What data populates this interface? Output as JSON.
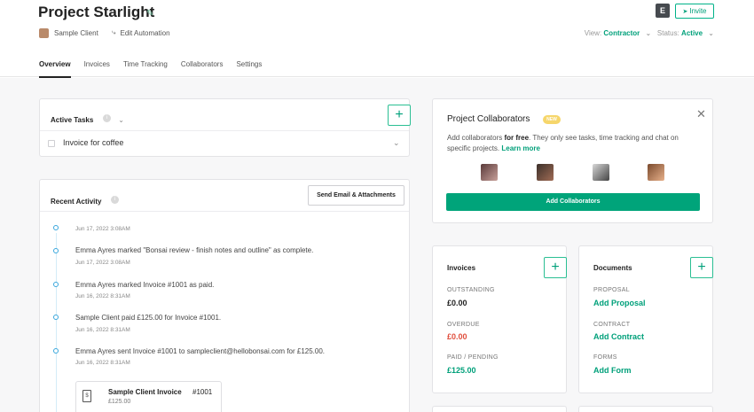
{
  "header": {
    "title": "Project Starlight",
    "avatar_letter": "E",
    "invite_label": "Invite",
    "client_name": "Sample Client",
    "automation_label": "Edit Automation",
    "view_label": "View:",
    "view_value": "Contractor",
    "status_label": "Status:",
    "status_value": "Active"
  },
  "tabs": [
    "Overview",
    "Invoices",
    "Time Tracking",
    "Collaborators",
    "Settings"
  ],
  "active_tasks": {
    "title": "Active Tasks",
    "task": "Invoice for coffee"
  },
  "recent_activity": {
    "title": "Recent Activity",
    "send_button": "Send Email & Attachments",
    "items": [
      {
        "text": "",
        "time": "Jun 17, 2022 3:08AM"
      },
      {
        "text": "Emma Ayres marked \"Bonsai review - finish notes and outline\" as complete.",
        "time": "Jun 17, 2022 3:08AM"
      },
      {
        "text": "Emma Ayres marked Invoice #1001 as paid.",
        "time": "Jun 16, 2022 8:31AM"
      },
      {
        "text": "Sample Client paid £125.00 for Invoice #1001.",
        "time": "Jun 16, 2022 8:31AM"
      },
      {
        "text": "Emma Ayres sent Invoice #1001 to sampleclient@hellobonsai.com for £125.00.",
        "time": "Jun 16, 2022 8:31AM"
      }
    ],
    "invoice_card": {
      "title": "Sample Client Invoice",
      "number": "#1001",
      "amount": "£125.00"
    }
  },
  "collaborators": {
    "title": "Project Collaborators",
    "badge": "NEW",
    "desc_1": "Add collaborators ",
    "desc_bold": "for free",
    "desc_2": ". They only see tasks, time tracking and chat on specific projects. ",
    "learn_more": "Learn more",
    "add_button": "Add Collaborators"
  },
  "invoices": {
    "title": "Invoices",
    "outstanding_label": "OUTSTANDING",
    "outstanding_value": "£0.00",
    "overdue_label": "OVERDUE",
    "overdue_value": "£0.00",
    "paid_label": "PAID / PENDING",
    "paid_value": "£125.00"
  },
  "documents": {
    "title": "Documents",
    "proposal_label": "PROPOSAL",
    "proposal_link": "Add Proposal",
    "contract_label": "CONTRACT",
    "contract_link": "Add Contract",
    "forms_label": "FORMS",
    "forms_link": "Add Form"
  },
  "colors": {
    "accent": "#00a07a",
    "overdue": "#e04e3d",
    "timeline": "#37a6dc"
  }
}
